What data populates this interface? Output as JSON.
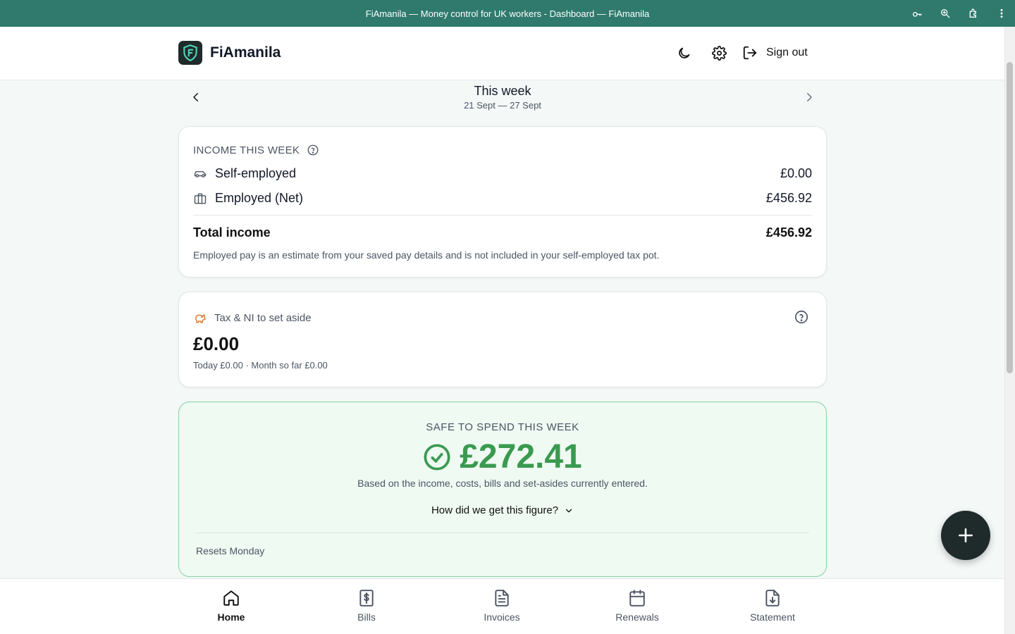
{
  "window": {
    "title": "FiAmanila — Money control for UK workers - Dashboard — FiAmanila",
    "icons": [
      "key-icon",
      "zoom-icon",
      "extension-icon",
      "more-icon"
    ]
  },
  "header": {
    "brand": "FiAmanila",
    "sign_out": "Sign out"
  },
  "week": {
    "title": "This week",
    "range": "21 Sept — 27 Sept"
  },
  "income": {
    "label": "INCOME THIS WEEK",
    "rows": [
      {
        "label": "Self-employed",
        "value": "£0.00",
        "icon": "car-icon"
      },
      {
        "label": "Employed (Net)",
        "value": "£456.92",
        "icon": "briefcase-icon"
      }
    ],
    "total_label": "Total income",
    "total_value": "£456.92",
    "note": "Employed pay is an estimate from your saved pay details and is not included in your self-employed tax pot."
  },
  "tax": {
    "label": "Tax & NI to set aside",
    "amount": "£0.00",
    "sub": "Today £0.00 · Month so far £0.00"
  },
  "safe": {
    "label": "SAFE TO SPEND THIS WEEK",
    "amount": "£272.41",
    "basis": "Based on the income, costs, bills and set-asides currently entered.",
    "how_label": "How did we get this figure?",
    "resets": "Resets Monday"
  },
  "nav": {
    "items": [
      {
        "label": "Home",
        "icon": "home-icon",
        "active": true
      },
      {
        "label": "Bills",
        "icon": "bills-icon",
        "active": false
      },
      {
        "label": "Invoices",
        "icon": "invoice-icon",
        "active": false
      },
      {
        "label": "Renewals",
        "icon": "calendar-icon",
        "active": false
      },
      {
        "label": "Statement",
        "icon": "statement-download-icon",
        "active": false
      }
    ]
  },
  "colors": {
    "titlebar": "#2f7a6c",
    "accent_green": "#3a9a4f",
    "tax_orange": "#e07b2a",
    "brand_dark": "#1f2a2a"
  }
}
